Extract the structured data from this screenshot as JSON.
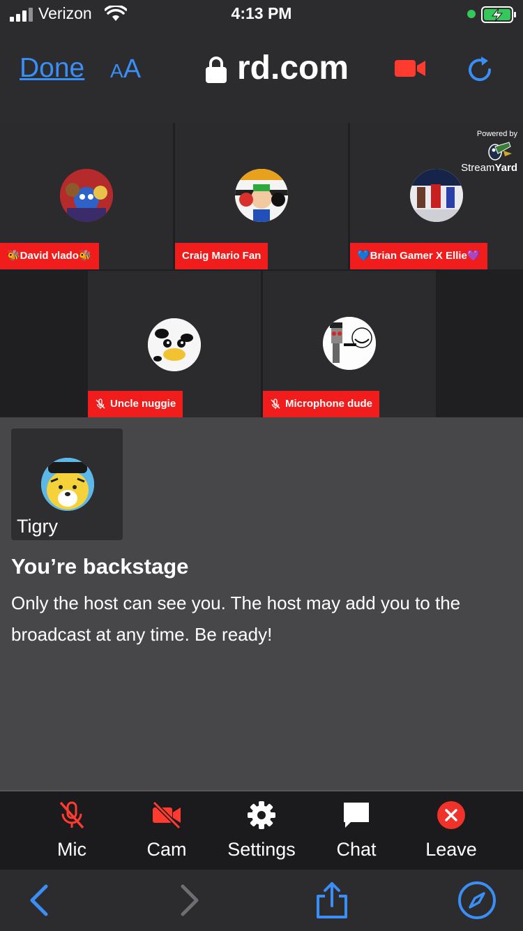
{
  "status_bar": {
    "carrier": "Verizon",
    "time": "4:13 PM",
    "battery": "charging"
  },
  "browser": {
    "done_label": "Done",
    "aa_small": "A",
    "aa_big": "A",
    "url": "rd.com",
    "accent_color": "#3a8ff7"
  },
  "stage": {
    "participants": [
      {
        "name": "🐝David vlado🐝",
        "muted": false
      },
      {
        "name": "Craig Mario Fan",
        "muted": false
      },
      {
        "name": "💙Brian Gamer X Ellie💜",
        "muted": false
      },
      {
        "name": "Uncle nuggie",
        "muted": true
      },
      {
        "name": "Microphone dude",
        "muted": true
      }
    ],
    "branding": {
      "powered_by": "Powered by",
      "brand_light": "Stream",
      "brand_bold": "Yard"
    },
    "tag_color": "#f11c1c"
  },
  "backstage": {
    "self_name": "Tigry",
    "title": "You’re backstage",
    "message": "Only the host can see you. The host may add you to the broadcast at any time. Be ready!"
  },
  "controls": {
    "mic": {
      "label": "Mic",
      "icon": "mic-off-icon"
    },
    "cam": {
      "label": "Cam",
      "icon": "camera-off-icon"
    },
    "settings": {
      "label": "Settings",
      "icon": "gear-icon"
    },
    "chat": {
      "label": "Chat",
      "icon": "chat-bubble-icon"
    },
    "leave": {
      "label": "Leave",
      "icon": "close-circle-icon"
    }
  },
  "safari_toolbar": {
    "icons": [
      "back-icon",
      "forward-icon",
      "share-icon",
      "compass-icon"
    ]
  }
}
